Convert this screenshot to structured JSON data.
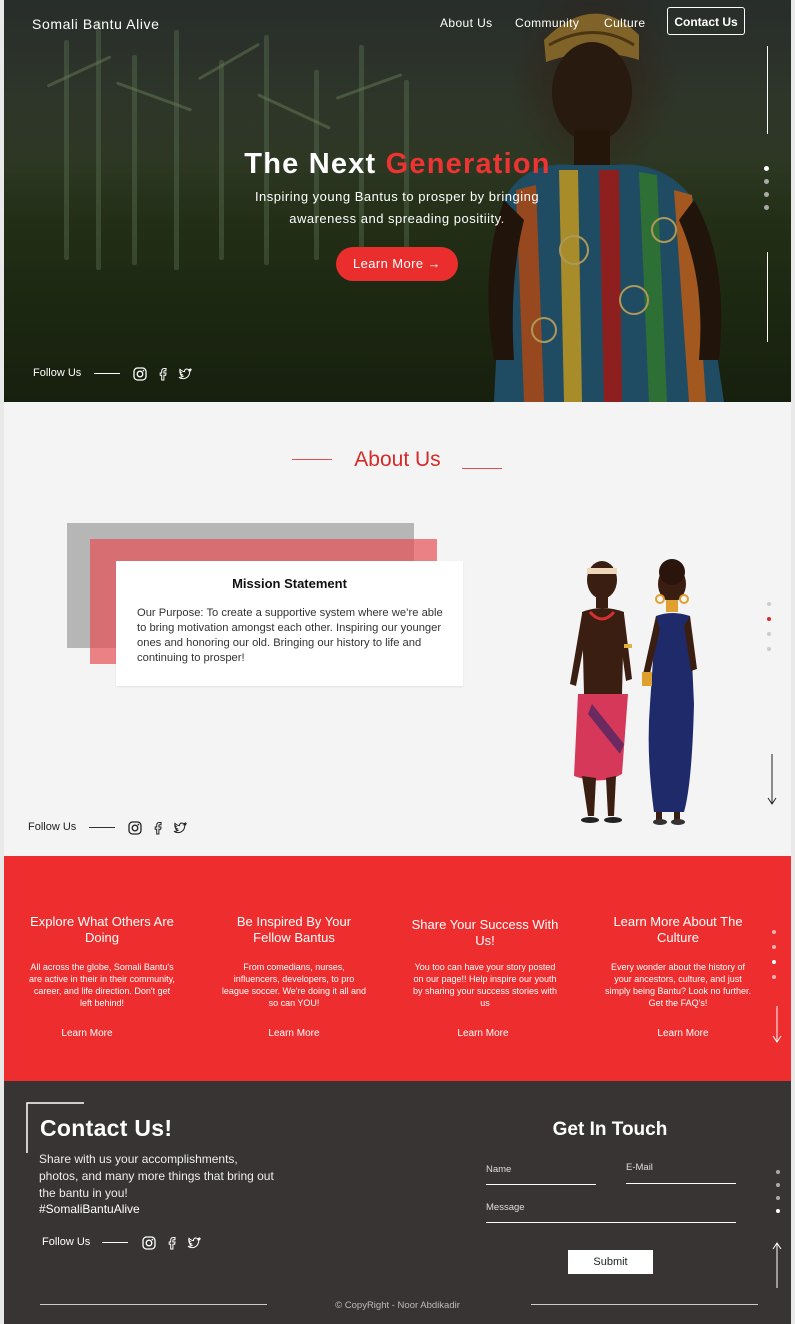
{
  "nav": {
    "brand": "Somali Bantu Alive",
    "links": [
      "About Us",
      "Community",
      "Culture"
    ],
    "contact": "Contact Us"
  },
  "hero": {
    "title_white": "The Next",
    "title_red": "Generation",
    "subtitle": "Inspiring young Bantus to prosper by bringing awareness and spreading positiity.",
    "button": "Learn More →"
  },
  "follow": {
    "label": "Follow Us",
    "icons": [
      "instagram-icon",
      "facebook-icon",
      "twitter-icon"
    ]
  },
  "about": {
    "title": "About Us",
    "mission_title": "Mission Statement",
    "mission_text": "Our Purpose: To create a supportive system where we’re able to bring motivation amongst each other. Inspiring our younger ones and honoring our old. Bringing our history to life and continuing to prosper!"
  },
  "features": [
    {
      "title": "Explore What Others Are Doing",
      "text": "All across the globe, Somali Bantu's are active in their in their community, career, and life direction. Don't get left behind!",
      "link": "Learn More"
    },
    {
      "title": "Be Inspired By Your Fellow Bantus",
      "text": "From comedians, nurses, influencers, developers, to pro league soccer. We're doing it all and so can YOU!",
      "link": "Learn More"
    },
    {
      "title": "Share Your Success With Us!",
      "text": "You too can have your story posted on our page!! Help inspire our youth by sharing your success stories with us",
      "link": "Learn More"
    },
    {
      "title": "Learn More About The Culture",
      "text": "Every wonder about the history of your ancestors, culture, and just simply being Bantu? Look no further. Get the FAQ's!",
      "link": "Learn More"
    }
  ],
  "contact": {
    "title": "Contact Us!",
    "text": "Share with us your accomplishments, photos, and many more things that bring out the bantu in you!",
    "hashtag": "#SomaliBantuAlive",
    "form_title": "Get In Touch",
    "name_placeholder": "Name",
    "email_placeholder": "E-Mail",
    "message_placeholder": "Message",
    "submit": "Submit",
    "copyright": "© CopyRight - Noor Abdikadir"
  },
  "colors": {
    "accent": "#ee2e2e",
    "dark": "#383434",
    "light": "#f4f4f4"
  }
}
